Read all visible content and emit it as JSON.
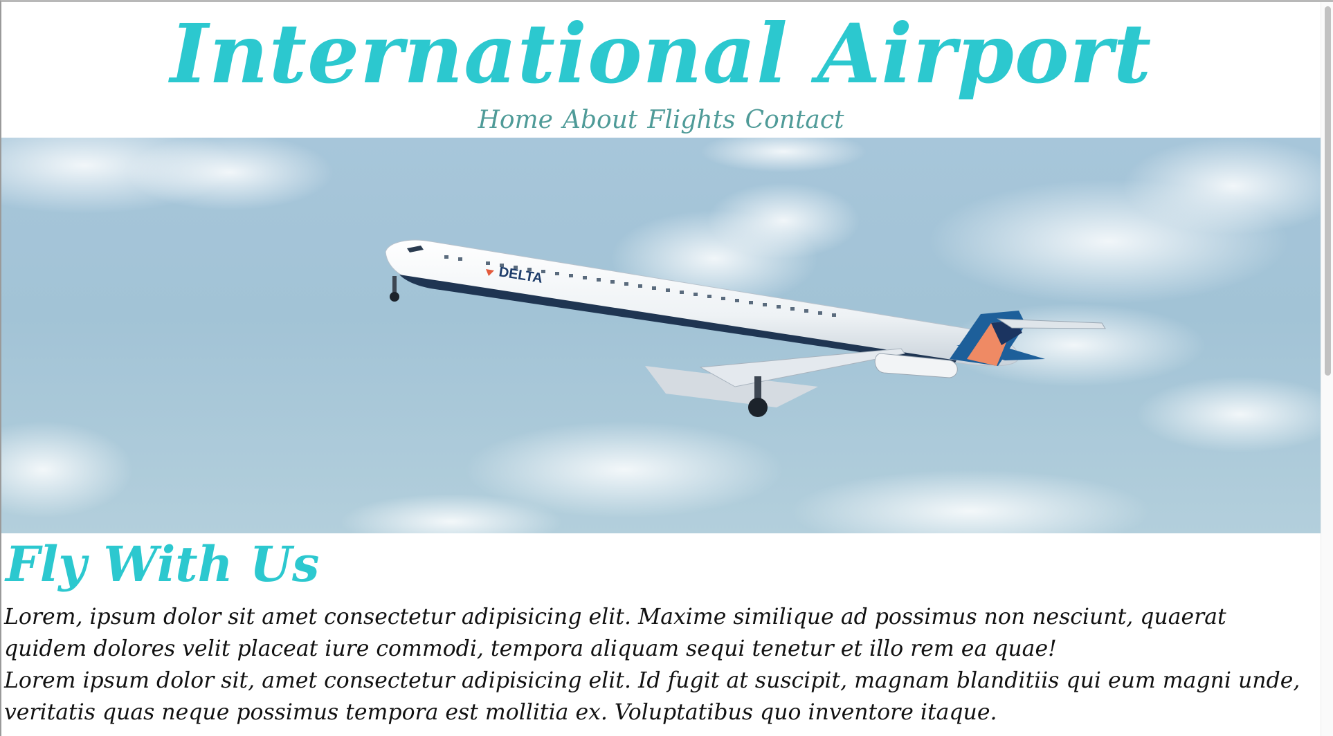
{
  "site": {
    "title": "International Airport"
  },
  "nav": {
    "items": [
      {
        "label": "Home"
      },
      {
        "label": "About"
      },
      {
        "label": "Flights"
      },
      {
        "label": "Contact"
      }
    ]
  },
  "hero": {
    "image": "airplane-taking-off",
    "livery_text": "DELTA"
  },
  "content": {
    "heading": "Fly With Us",
    "paragraphs": [
      "Lorem, ipsum dolor sit amet consectetur adipisicing elit. Maxime similique ad possimus non nesciunt, quaerat quidem dolores velit placeat iure commodi, tempora aliquam sequi tenetur et illo rem ea quae!",
      "Lorem ipsum dolor sit, amet consectetur adipisicing elit. Id fugit at suscipit, magnam blanditiis qui eum magni unde, veritatis quas neque possimus tempora est mollitia ex. Voluptatibus quo inventore itaque."
    ]
  },
  "colors": {
    "accent": "#2cc8cf",
    "nav": "#4f9b98",
    "text": "#111111",
    "sky": "#a7c6da"
  }
}
